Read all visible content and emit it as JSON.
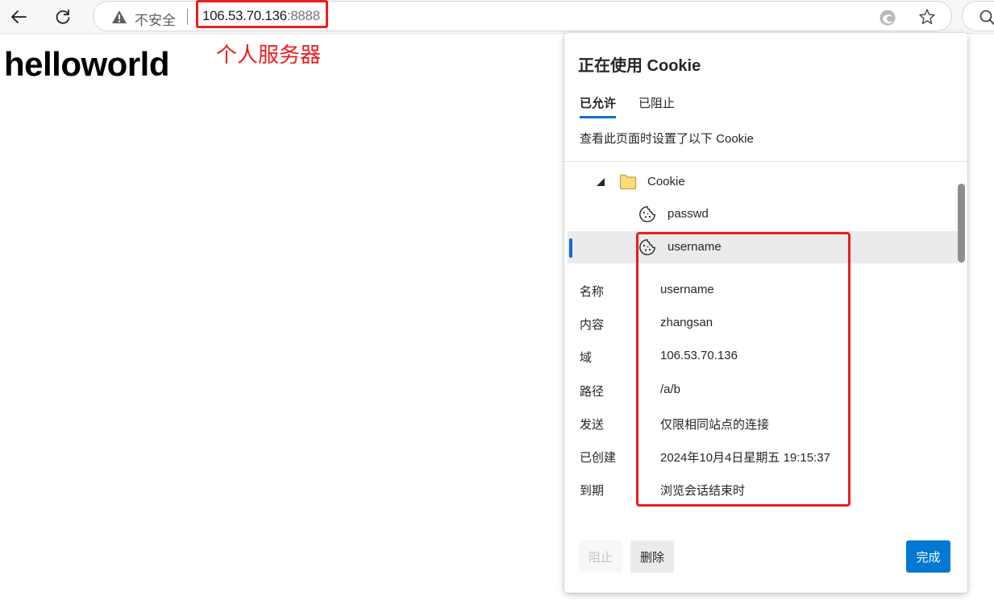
{
  "toolbar": {
    "back_icon": "arrow-left-icon",
    "reload_icon": "reload-icon",
    "security_label": "不安全",
    "url_host": "106.53.70.136",
    "url_port": ":8888",
    "edge_icon": "edge-icon",
    "favorite_icon": "star-icon",
    "search_icon": "search-icon"
  },
  "page": {
    "heading": "helloworld",
    "annotation": "个人服务器"
  },
  "cookie_panel": {
    "title": "正在使用 Cookie",
    "tabs": [
      {
        "label": "已允许",
        "active": true
      },
      {
        "label": "已阻止",
        "active": false
      }
    ],
    "description": "查看此页面时设置了以下 Cookie",
    "tree": {
      "folder_label": "Cookie",
      "items": [
        {
          "label": "passwd",
          "selected": false
        },
        {
          "label": "username",
          "selected": true
        }
      ]
    },
    "details": [
      {
        "key": "名称",
        "value": "username"
      },
      {
        "key": "内容",
        "value": "zhangsan"
      },
      {
        "key": "域",
        "value": "106.53.70.136"
      },
      {
        "key": "路径",
        "value": "/a/b"
      },
      {
        "key": "发送",
        "value": "仅限相同站点的连接"
      },
      {
        "key": "已创建",
        "value": "2024年10月4日星期五 19:15:37"
      },
      {
        "key": "到期",
        "value": "浏览会话结束时"
      }
    ],
    "buttons": {
      "block": "阻止",
      "delete": "删除",
      "done": "完成"
    }
  },
  "colors": {
    "accent": "#0078d4",
    "annotation_red": "#ee1c1c"
  }
}
